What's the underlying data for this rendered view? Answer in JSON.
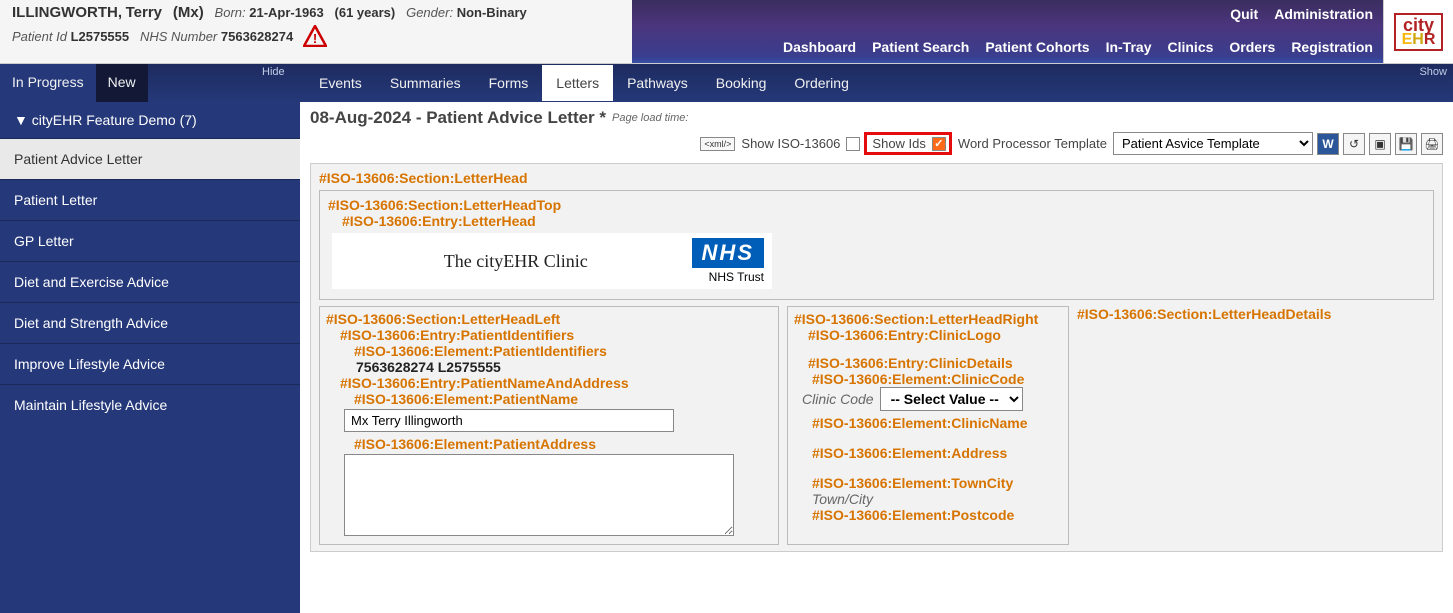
{
  "patient": {
    "surname": "ILLINGWORTH,",
    "firstname": "Terry",
    "title": "(Mx)",
    "born_label": "Born:",
    "born_val": "21-Apr-1963",
    "age": "(61 years)",
    "gender_label": "Gender:",
    "gender_val": "Non-Binary",
    "pidsub_label": "Patient Id",
    "pid_val": "L2575555",
    "nhs_label": "NHS Number",
    "nhs_val": "7563628274"
  },
  "topnav": {
    "quit": "Quit",
    "admin": "Administration",
    "links": [
      "Dashboard",
      "Patient Search",
      "Patient Cohorts",
      "In-Tray",
      "Clinics",
      "Orders",
      "Registration"
    ]
  },
  "logo": {
    "city": "city",
    "ehr_e": "E",
    "ehr_h": "H",
    "ehr_r": "R"
  },
  "menu": {
    "in_progress": "In Progress",
    "new": "New",
    "hide": "Hide",
    "show": "Show",
    "tabs": [
      "Events",
      "Summaries",
      "Forms",
      "Letters",
      "Pathways",
      "Booking",
      "Ordering"
    ]
  },
  "sidebar": {
    "header": "▼ cityEHR Feature Demo (7)",
    "items": [
      "Patient Advice Letter",
      "Patient Letter",
      "GP Letter",
      "Diet and Exercise Advice",
      "Diet and Strength Advice",
      "Improve Lifestyle Advice",
      "Maintain Lifestyle Advice"
    ]
  },
  "main": {
    "title": "08-Aug-2024 - Patient Advice Letter *",
    "page_load": "Page load time:",
    "xml_btn": "<xml/>",
    "show_iso_label": "Show ISO-13606",
    "show_ids_label": "Show Ids",
    "wp_label": "Word Processor Template",
    "wp_value": "Patient Asvice Template"
  },
  "iso": {
    "section_letterhead": "#ISO-13606:Section:LetterHead",
    "section_letterheadtop": "#ISO-13606:Section:LetterHeadTop",
    "entry_letterhead": "#ISO-13606:Entry:LetterHead",
    "clinic_banner_name": "The cityEHR Clinic",
    "nhs": "NHS",
    "nhs_trust": "NHS Trust",
    "section_left": "#ISO-13606:Section:LetterHeadLeft",
    "entry_pid": "#ISO-13606:Entry:PatientIdentifiers",
    "elem_pid": "#ISO-13606:Element:PatientIdentifiers",
    "pid_value": "7563628274 L2575555",
    "entry_name_addr": "#ISO-13606:Entry:PatientNameAndAddress",
    "elem_pname": "#ISO-13606:Element:PatientName",
    "pname_value": "Mx Terry Illingworth",
    "elem_paddr": "#ISO-13606:Element:PatientAddress",
    "section_right": "#ISO-13606:Section:LetterHeadRight",
    "entry_cliniclogo": "#ISO-13606:Entry:ClinicLogo",
    "entry_clinicdetails": "#ISO-13606:Entry:ClinicDetails",
    "elem_cliniccode": "#ISO-13606:Element:ClinicCode",
    "cliniccode_label": "Clinic Code",
    "cliniccode_select": "-- Select Value --",
    "elem_clinicname": "#ISO-13606:Element:ClinicName",
    "elem_address": "#ISO-13606:Element:Address",
    "elem_towncity": "#ISO-13606:Element:TownCity",
    "towncity_label": "Town/City",
    "elem_postcode": "#ISO-13606:Element:Postcode",
    "section_details": "#ISO-13606:Section:LetterHeadDetails"
  }
}
